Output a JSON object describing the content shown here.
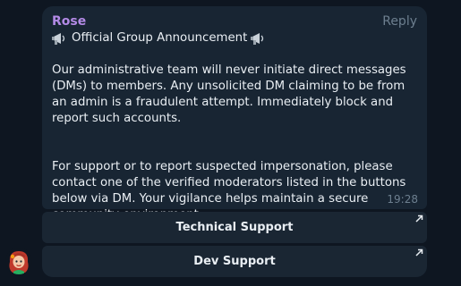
{
  "message": {
    "sender": "Rose",
    "reply_label": "Reply",
    "title": "Official Group Announcement",
    "paragraph1": "Our administrative team will never initiate direct messages (DMs) to members. Any unsolicited DM claiming to be from an admin is a fraudulent attempt. Immediately block and report such accounts.",
    "paragraph2": "For support or to report suspected impersonation, please contact one of the verified moderators listed in the buttons below via DM. Your vigilance helps maintain a secure community environment.",
    "time": "19:28"
  },
  "buttons": [
    {
      "label": "Technical Support",
      "icon": "external-link-arrow-icon"
    },
    {
      "label": "Dev Support",
      "icon": "external-link-arrow-icon"
    }
  ],
  "colors": {
    "background": "#0e1621",
    "bubble": "#182533",
    "sender": "#b38ae6",
    "muted": "#6d7f8f",
    "text": "#e9eef3"
  },
  "icons": {
    "title_emoji": "megaphone-icon",
    "avatar": "avatar-girl-red-hair"
  }
}
